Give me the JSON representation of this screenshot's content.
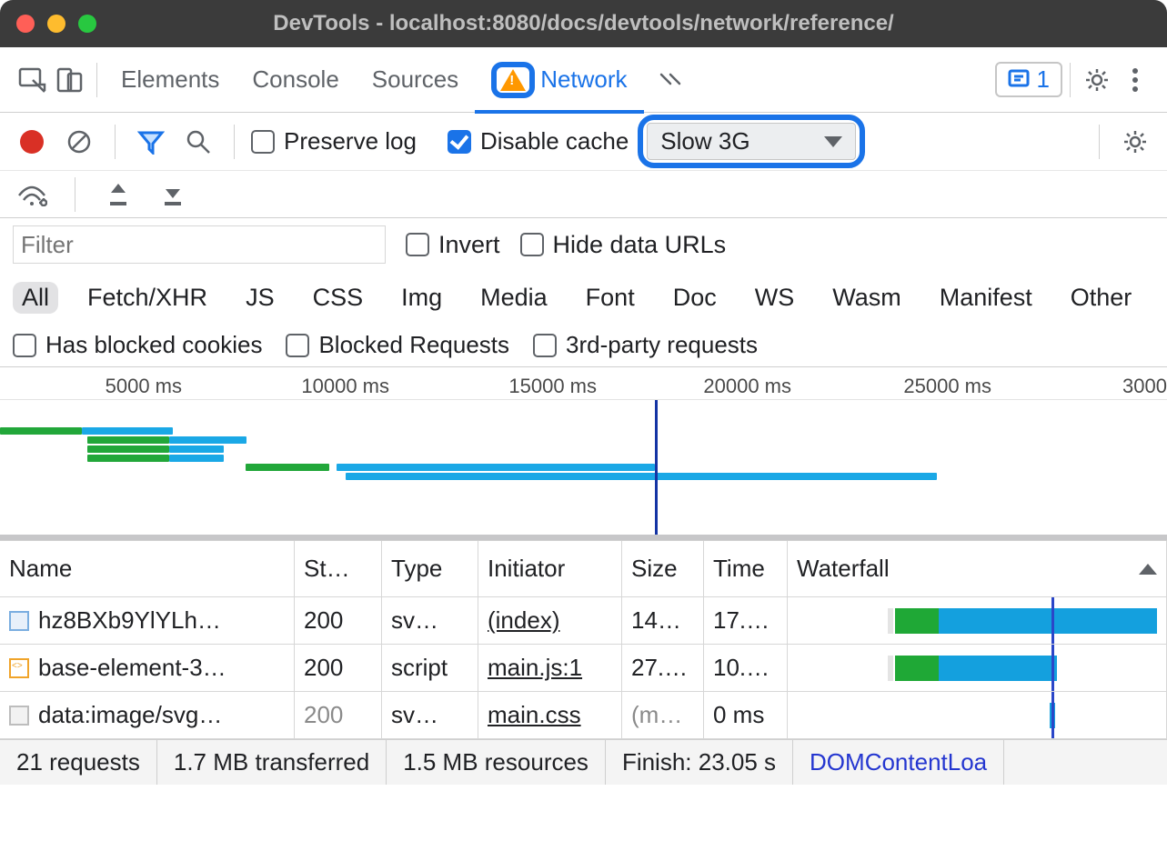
{
  "window": {
    "title": "DevTools - localhost:8080/docs/devtools/network/reference/"
  },
  "tabs": {
    "items": [
      "Elements",
      "Console",
      "Sources",
      "Network"
    ],
    "active": "Network",
    "issues_count": "1"
  },
  "toolbar": {
    "preserve_log": "Preserve log",
    "disable_cache": "Disable cache",
    "throttling": "Slow 3G"
  },
  "filter": {
    "placeholder": "Filter",
    "invert": "Invert",
    "hide_data_urls": "Hide data URLs"
  },
  "types": [
    "All",
    "Fetch/XHR",
    "JS",
    "CSS",
    "Img",
    "Media",
    "Font",
    "Doc",
    "WS",
    "Wasm",
    "Manifest",
    "Other"
  ],
  "types_active": "All",
  "extra_filters": {
    "blocked_cookies": "Has blocked cookies",
    "blocked_requests": "Blocked Requests",
    "third_party": "3rd-party requests"
  },
  "overview": {
    "ticks": [
      "5000 ms",
      "10000 ms",
      "15000 ms",
      "20000 ms",
      "25000 ms",
      "3000"
    ]
  },
  "columns": {
    "name": "Name",
    "status": "St…",
    "type": "Type",
    "initiator": "Initiator",
    "size": "Size",
    "time": "Time",
    "waterfall": "Waterfall"
  },
  "rows": [
    {
      "name": "hz8BXb9YlYLh…",
      "status": "200",
      "type": "sv…",
      "initiator": "(index)",
      "size": "14…",
      "time": "17.…"
    },
    {
      "name": "base-element-3…",
      "status": "200",
      "type": "script",
      "initiator": "main.js:1",
      "size": "27.…",
      "time": "10.…"
    },
    {
      "name": "data:image/svg…",
      "status": "200",
      "type": "sv…",
      "initiator": "main.css",
      "size": "(m…",
      "time": "0 ms"
    }
  ],
  "status": {
    "requests": "21 requests",
    "transferred": "1.7 MB transferred",
    "resources": "1.5 MB resources",
    "finish": "Finish: 23.05 s",
    "dcl": "DOMContentLoa"
  },
  "chart_data": {
    "type": "bar",
    "title": "Network overview timeline",
    "xlabel": "ms",
    "ylabel": "",
    "categories": [
      "5000 ms",
      "10000 ms",
      "15000 ms",
      "20000 ms",
      "25000 ms",
      "30000 ms"
    ],
    "series": [
      {
        "name": "hz8BXb9YlYLh…",
        "start_ms": 6800,
        "ttfb_ms": 8400,
        "end_ms": 24000
      },
      {
        "name": "base-element-3…",
        "start_ms": 6800,
        "ttfb_ms": 8400,
        "end_ms": 17600
      },
      {
        "name": "data:image/svg…",
        "start_ms": 17200,
        "ttfb_ms": 17200,
        "end_ms": 17200
      }
    ],
    "cursor_ms": 17200,
    "xlim": [
      0,
      30000
    ]
  }
}
